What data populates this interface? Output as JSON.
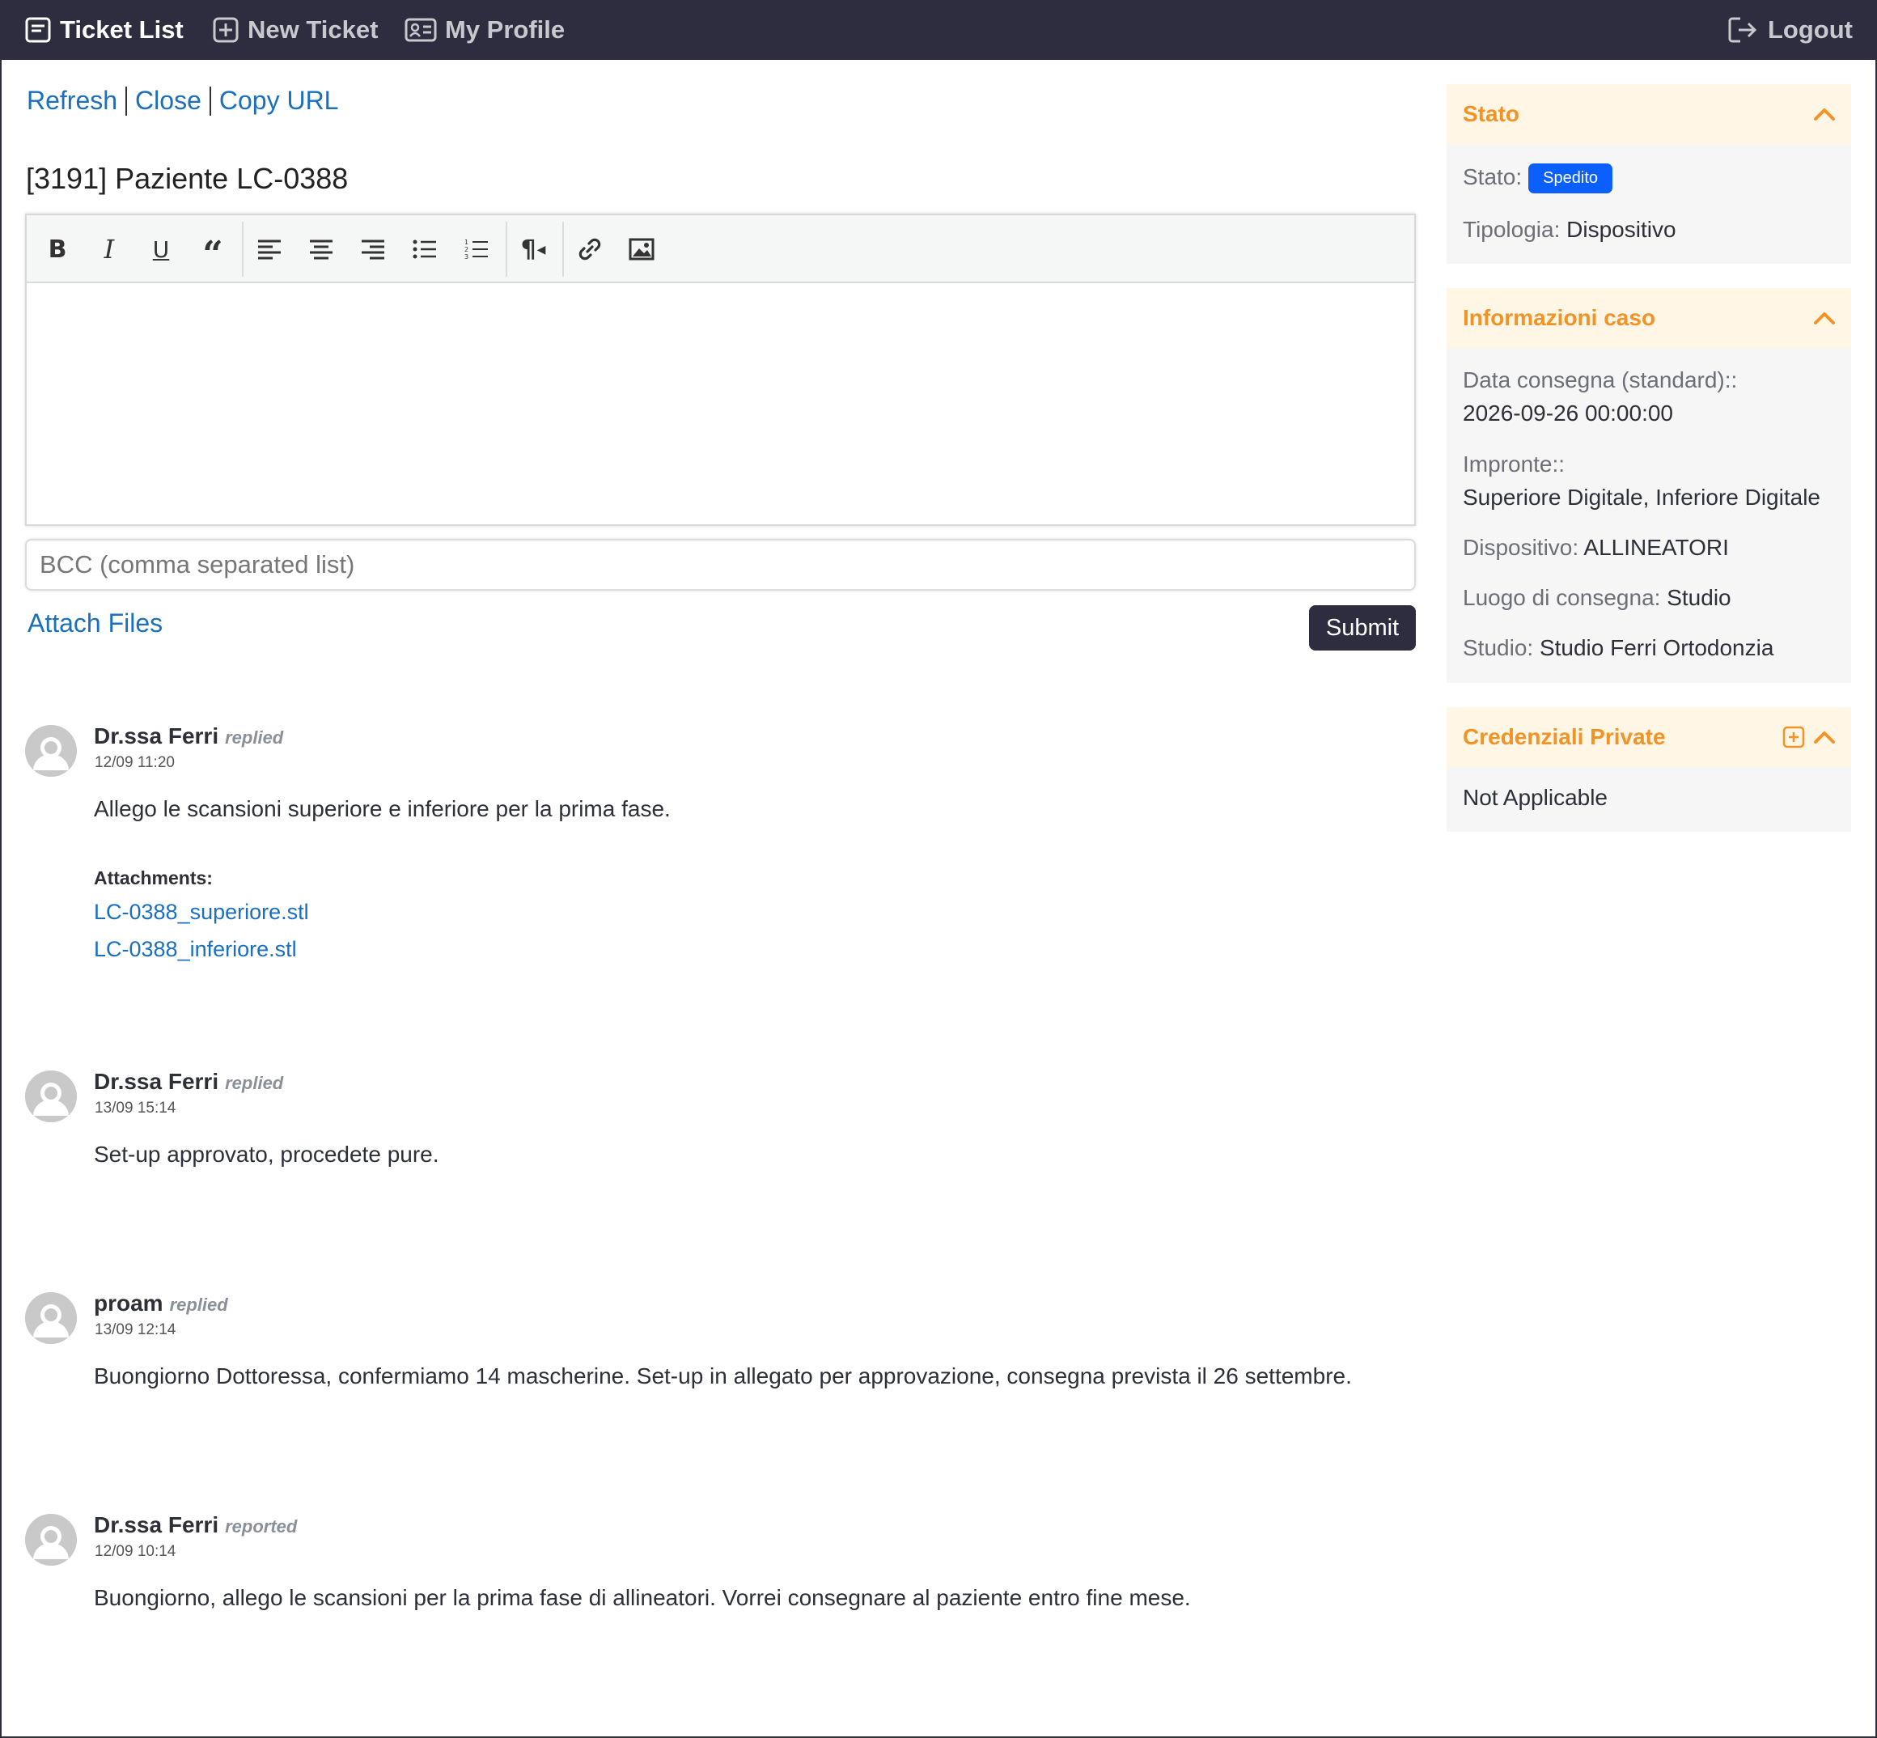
{
  "nav": {
    "ticket_list": "Ticket List",
    "new_ticket": "New Ticket",
    "my_profile": "My Profile",
    "logout": "Logout"
  },
  "actions": {
    "refresh": "Refresh",
    "close": "Close",
    "copy_url": "Copy URL"
  },
  "ticket": {
    "title": "[3191] Paziente LC-0388"
  },
  "editor": {
    "toolbar_icons": [
      "bold-icon",
      "italic-icon",
      "underline-icon",
      "quote-icon",
      "align-left-icon",
      "align-center-icon",
      "align-right-icon",
      "bullet-list-icon",
      "numbered-list-icon",
      "paragraph-direction-icon",
      "link-icon",
      "image-icon"
    ],
    "content": ""
  },
  "bcc": {
    "placeholder": "BCC (comma separated list)",
    "value": ""
  },
  "attach_files": "Attach Files",
  "submit": "Submit",
  "messages": [
    {
      "author": "Dr.ssa Ferri",
      "verb": "replied",
      "time": "12/09 11:20",
      "text": "Allego le scansioni superiore e inferiore per la prima fase.",
      "attachments_label": "Attachments:",
      "attachments": [
        "LC-0388_superiore.stl",
        "LC-0388_inferiore.stl"
      ]
    },
    {
      "author": "Dr.ssa Ferri",
      "verb": "replied",
      "time": "13/09 15:14",
      "text": "Set-up approvato, procedete pure."
    },
    {
      "author": "proam",
      "verb": "replied",
      "time": "13/09 12:14",
      "text": "Buongiorno Dottoressa, confermiamo 14 mascherine. Set-up in allegato per approvazione, consegna prevista il 26 settembre."
    },
    {
      "author": "Dr.ssa Ferri",
      "verb": "reported",
      "time": "12/09 10:14",
      "text": "Buongiorno, allego le scansioni per la prima fase di allineatori. Vorrei consegnare al paziente entro fine mese."
    }
  ],
  "panels": {
    "stato": {
      "title": "Stato",
      "stato_label": "Stato:",
      "stato_value": "Spedito",
      "tipologia_label": "Tipologia:",
      "tipologia_value": "Dispositivo"
    },
    "info": {
      "title": "Informazioni caso",
      "data_label": "Data consegna (standard)::",
      "data_value": "2026-09-26 00:00:00",
      "impronte_label": "Impronte::",
      "impronte_value": "Superiore Digitale, Inferiore Digitale",
      "dispositivo_label": "Dispositivo:",
      "dispositivo_value": "ALLINEATORI",
      "luogo_label": "Luogo di consegna:",
      "luogo_value": "Studio",
      "studio_label": "Studio:",
      "studio_value": "Studio Ferri Ortodonzia"
    },
    "credenziali": {
      "title": "Credenziali Private",
      "value": "Not Applicable"
    }
  },
  "colors": {
    "navbar": "#2d2d3f",
    "link": "#1a6fbf",
    "panel_header_text": "#f29327",
    "panel_header_bg": "#fff6e5",
    "badge": "#0b5fff"
  }
}
